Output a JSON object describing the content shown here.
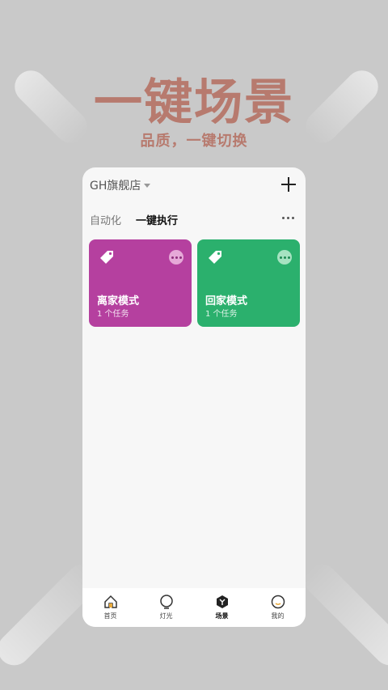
{
  "banner": {
    "headline": "一键场景",
    "subline": "品质，一键切换"
  },
  "header": {
    "store_name": "GH旗舰店"
  },
  "tabs": [
    {
      "label": "自动化"
    },
    {
      "label": "一键执行"
    }
  ],
  "scenes": [
    {
      "title": "离家模式",
      "subtitle": "1 个任务",
      "color": "#b5409f"
    },
    {
      "title": "回家模式",
      "subtitle": "1 个任务",
      "color": "#2bb06d"
    }
  ],
  "tabbar": [
    {
      "label": "首页",
      "icon": "home-icon"
    },
    {
      "label": "灯光",
      "icon": "light-icon"
    },
    {
      "label": "场景",
      "icon": "scene-icon"
    },
    {
      "label": "我的",
      "icon": "profile-icon"
    }
  ],
  "colors": {
    "accent_text": "#b77a6e",
    "background": "#c9c9c9"
  }
}
